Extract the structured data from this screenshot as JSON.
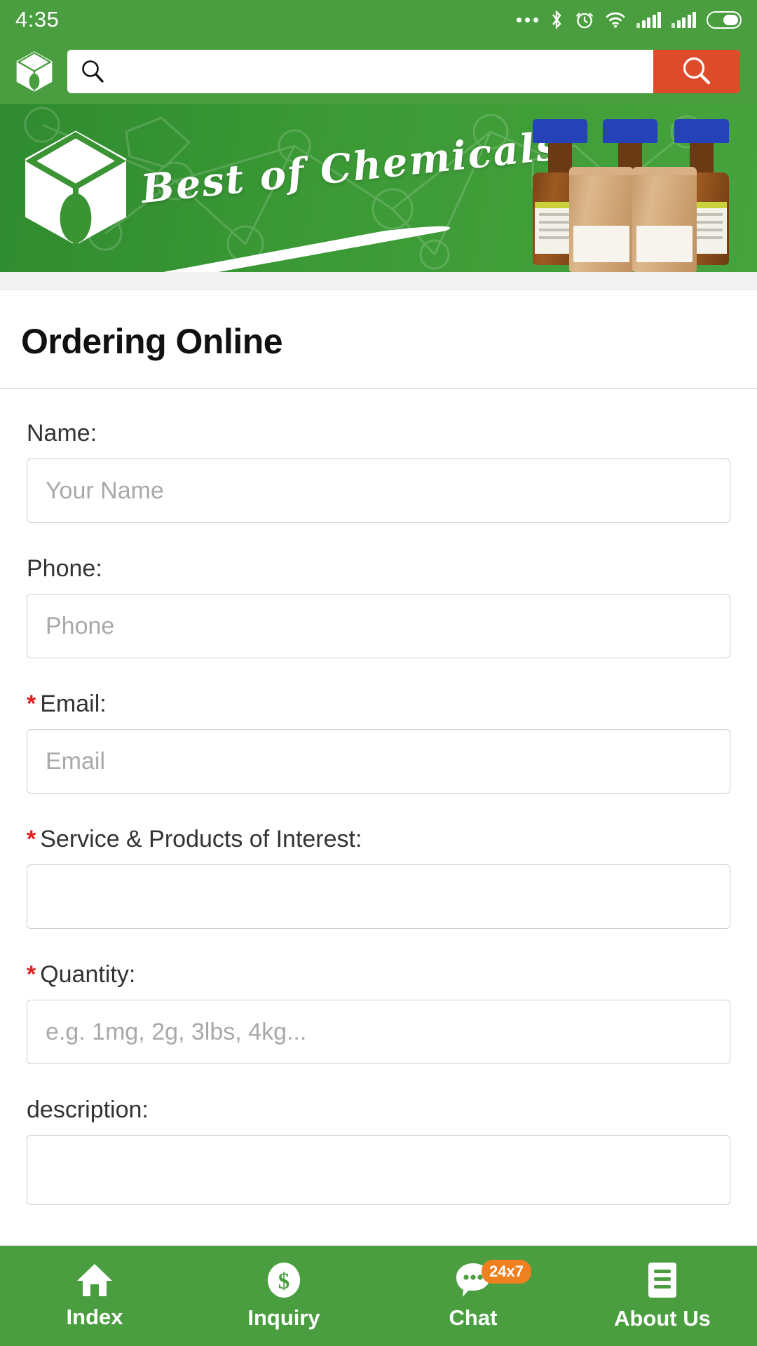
{
  "status_bar": {
    "time": "4:35",
    "icons": [
      "more-dots-icon",
      "bluetooth-icon",
      "alarm-icon",
      "wifi-icon",
      "signal-sim1-icon",
      "signal-sim2-icon",
      "battery-icon"
    ]
  },
  "header": {
    "logo": "cube-droplet-logo",
    "search_placeholder": "",
    "search_value": "",
    "search_button_icon": "search-icon",
    "accent_green": "#4a9e3f",
    "accent_red": "#dd4b2a"
  },
  "banner": {
    "script_text": "Best of Chemicals",
    "logo": "cube-droplet-logo"
  },
  "main": {
    "title": "Ordering Online",
    "fields": [
      {
        "label": "Name:",
        "required": false,
        "placeholder": "Your Name",
        "value": "",
        "type": "text",
        "name": "name"
      },
      {
        "label": "Phone:",
        "required": false,
        "placeholder": "Phone",
        "value": "",
        "type": "text",
        "name": "phone"
      },
      {
        "label": "Email:",
        "required": true,
        "placeholder": "Email",
        "value": "",
        "type": "text",
        "name": "email"
      },
      {
        "label": "Service & Products of Interest:",
        "required": true,
        "placeholder": "",
        "value": "",
        "type": "text",
        "name": "service-products"
      },
      {
        "label": "Quantity:",
        "required": true,
        "placeholder": "e.g. 1mg, 2g, 3lbs, 4kg...",
        "value": "",
        "type": "text",
        "name": "quantity"
      },
      {
        "label": "description:",
        "required": false,
        "placeholder": "",
        "value": "",
        "type": "textarea",
        "name": "description"
      }
    ],
    "required_marker": "*"
  },
  "tabbar": {
    "items": [
      {
        "label": "Index",
        "icon": "home-icon",
        "badge": ""
      },
      {
        "label": "Inquiry",
        "icon": "dollar-circle-icon",
        "badge": ""
      },
      {
        "label": "Chat",
        "icon": "chat-bubble-icon",
        "badge": "24x7"
      },
      {
        "label": "About Us",
        "icon": "document-list-icon",
        "badge": ""
      }
    ],
    "badge_color": "#ef8020"
  }
}
